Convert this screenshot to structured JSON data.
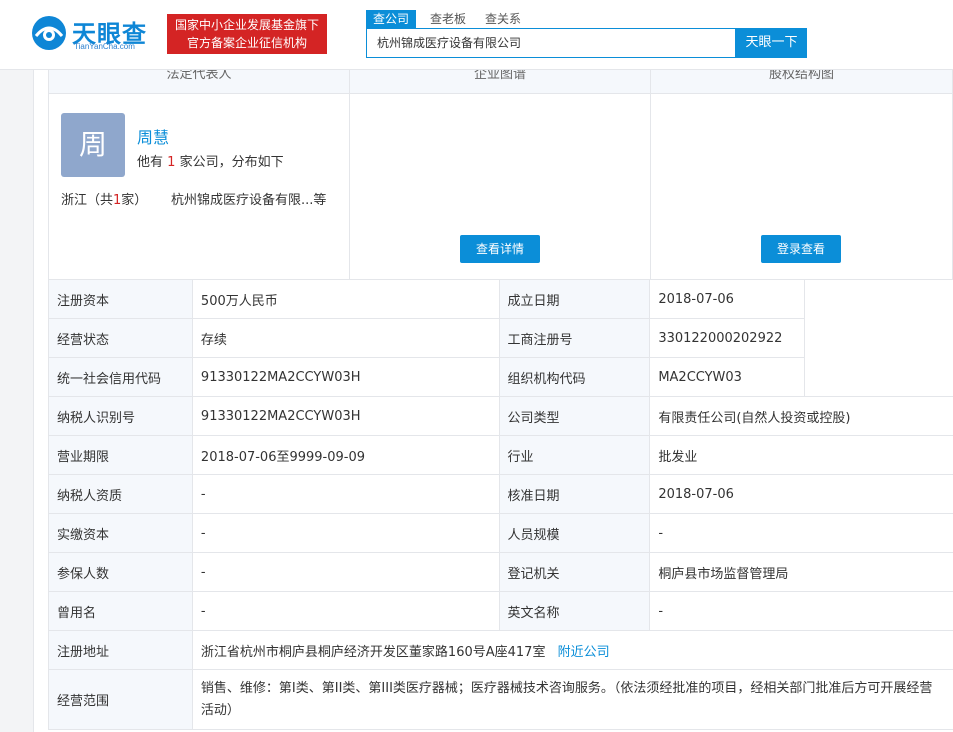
{
  "header": {
    "logo_text": "天眼查",
    "logo_sub": "TianYanCha.com",
    "banner_line1": "国家中小企业发展基金旗下",
    "banner_line2": "官方备案企业征信机构",
    "tabs": [
      "查公司",
      "查老板",
      "查关系"
    ],
    "search_value": "杭州锦成医疗设备有限公司",
    "search_button": "天眼一下"
  },
  "sections": {
    "legal_rep": "法定代表人",
    "map": "企业图谱",
    "equity": "股权结构图"
  },
  "person": {
    "avatar_char": "周",
    "name": "周慧",
    "desc_prefix": "他有",
    "count": "1",
    "desc_suffix": "家公司，分布如下",
    "region_prefix": "浙江（共",
    "region_count": "1",
    "region_suffix": "家）",
    "region_company": "杭州锦成医疗设备有限...等"
  },
  "buttons": {
    "view_details": "查看详情",
    "login_view": "登录查看"
  },
  "info": {
    "reg_capital_label": "注册资本",
    "reg_capital": "500万人民币",
    "est_date_label": "成立日期",
    "est_date": "2018-07-06",
    "status_label": "经营状态",
    "status": "存续",
    "reg_no_label": "工商注册号",
    "reg_no": "330122000202922",
    "credit_code_label": "统一社会信用代码",
    "credit_code": "91330122MA2CCYW03H",
    "org_code_label": "组织机构代码",
    "org_code": "MA2CCYW03",
    "taxpayer_id_label": "纳税人识别号",
    "taxpayer_id": "91330122MA2CCYW03H",
    "company_type_label": "公司类型",
    "company_type": "有限责任公司(自然人投资或控股)",
    "term_label": "营业期限",
    "term": "2018-07-06至9999-09-09",
    "industry_label": "行业",
    "industry": "批发业",
    "tax_qual_label": "纳税人资质",
    "tax_qual": "-",
    "approve_date_label": "核准日期",
    "approve_date": "2018-07-06",
    "paid_capital_label": "实缴资本",
    "paid_capital": "-",
    "staff_label": "人员规模",
    "staff": "-",
    "insured_label": "参保人数",
    "insured": "-",
    "authority_label": "登记机关",
    "authority": "桐庐县市场监督管理局",
    "former_name_label": "曾用名",
    "former_name": "-",
    "english_name_label": "英文名称",
    "english_name": "-",
    "address_label": "注册地址",
    "address": "浙江省杭州市桐庐县桐庐经济开发区董家路160号A座417室",
    "nearby": "附近公司",
    "scope_label": "经营范围",
    "scope": "销售、维修：第I类、第II类、第III类医疗器械；医疗器械技术咨询服务。（依法须经批准的项目，经相关部门批准后方可开展经营活动）"
  },
  "colors": {
    "brand_blue": "#0b8ed8",
    "banner_red": "#d42424",
    "label_bg": "#f5f8fc"
  }
}
